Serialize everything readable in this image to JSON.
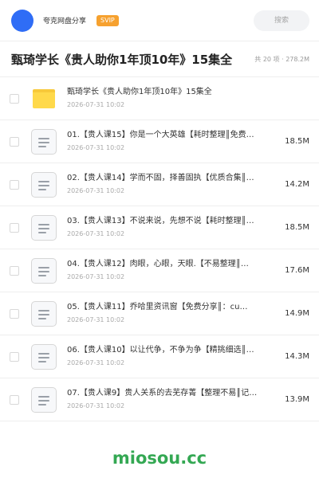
{
  "topbar": {
    "user_name": "夸克网盘分享",
    "badge": "SVIP",
    "search_placeholder": "搜索"
  },
  "folder": {
    "title": "甄琦学长《贵人助你1年顶10年》15集全",
    "meta": "共 20 项 · 278.2M"
  },
  "files": [
    {
      "name": "甄琦学长《贵人助你1年顶10年》15集全",
      "date": "2026-07-31 10:02",
      "size": "",
      "icon": "folder-icon"
    },
    {
      "name": "01.【贵人课15】你是一个大英雄【耗时整理║免费…",
      "date": "2026-07-31 10:02",
      "size": "18.5M",
      "icon": "document-icon"
    },
    {
      "name": "02.【贵人课14】学而不固，择善固执【优质合集║…",
      "date": "2026-07-31 10:02",
      "size": "14.2M",
      "icon": "document-icon"
    },
    {
      "name": "03.【贵人课13】不说来说，先想不说【耗时整理║…",
      "date": "2026-07-31 10:02",
      "size": "18.5M",
      "icon": "document-icon"
    },
    {
      "name": "04.【贵人课12】肉眼，心眼，天眼.【不易整理║…",
      "date": "2026-07-31 10:02",
      "size": "17.6M",
      "icon": "document-icon"
    },
    {
      "name": "05.【贵人课11】乔哈里资讯窗【免费分享║：cu…",
      "date": "2026-07-31 10:02",
      "size": "14.9M",
      "icon": "document-icon"
    },
    {
      "name": "06.【贵人课10】以让代争，不争为争【精挑细选║…",
      "date": "2026-07-31 10:02",
      "size": "14.3M",
      "icon": "document-icon"
    },
    {
      "name": "07.【贵人课9】贵人关系的去芜存菁【整理不易║记…",
      "date": "2026-07-31 10:02",
      "size": "13.9M",
      "icon": "document-icon"
    }
  ],
  "watermark": "miosou.cc",
  "colors": {
    "avatar": "#2f6df6",
    "badge": "#f6a12f",
    "folder": "#ffd94a",
    "watermark": "#34a853"
  }
}
